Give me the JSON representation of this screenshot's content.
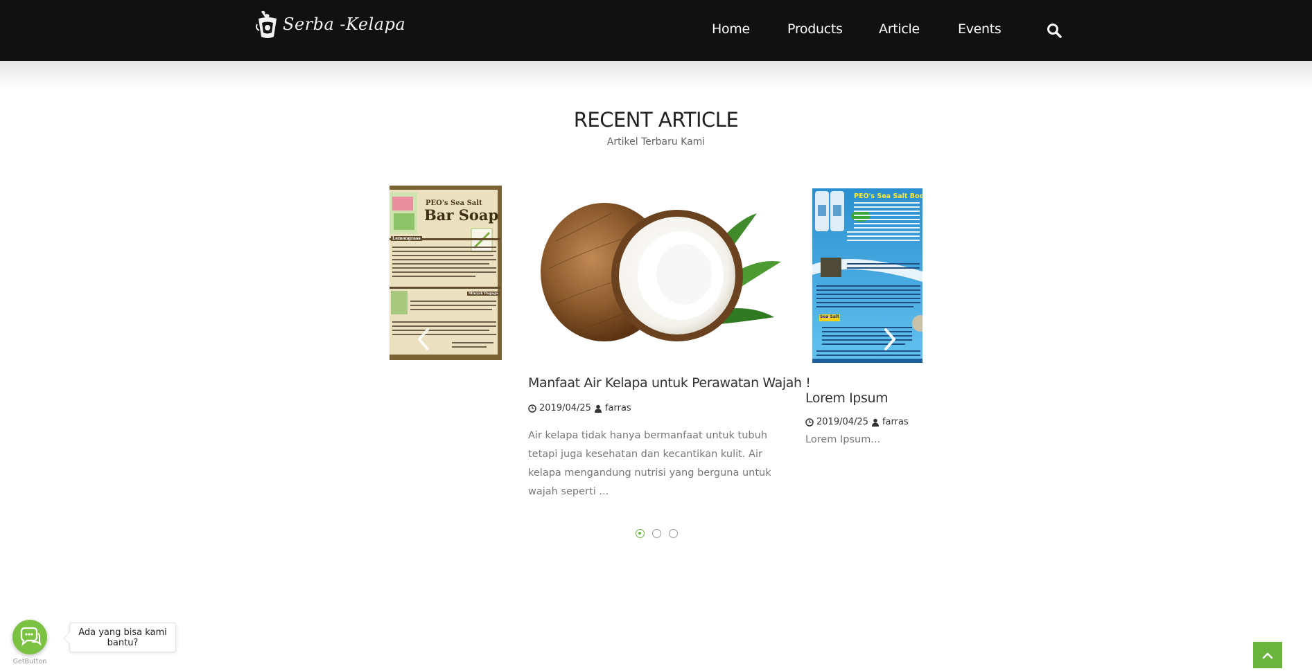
{
  "brand": {
    "name": "Serba -Kelapa"
  },
  "nav": {
    "items": [
      {
        "label": "Home"
      },
      {
        "label": "Products"
      },
      {
        "label": "Article"
      },
      {
        "label": "Events"
      }
    ],
    "search_icon": "search-icon"
  },
  "section": {
    "title": "RECENT ARTICLE",
    "subtitle": "Artikel Terbaru Kami"
  },
  "carousel": {
    "prev_icon": "chevron-left-icon",
    "next_icon": "chevron-right-icon",
    "slides": [
      {
        "image": "bar-soap-flyer",
        "image_text": {
          "brand": "PEO's Sea Salt",
          "product": "Bar Soap",
          "variant": "Lemongrass",
          "variant2": "Minyak Pegaga"
        }
      },
      {
        "image": "coconut-photo",
        "title": "Manfaat Air Kelapa untuk Perawatan Wajah !",
        "date": "2019/04/25",
        "author": "farras",
        "excerpt": "Air kelapa tidak hanya bermanfaat untuk tubuh tetapi juga kesehatan dan kecantikan kulit. Air kelapa mengandung nutrisi yang berguna untuk wajah seperti ..."
      },
      {
        "image": "body-soap-flyer",
        "image_text": {
          "banner": "PEO's Sea Salt Body so",
          "tag": "Sea Salt"
        },
        "title": "Lorem Ipsum",
        "date": "2019/04/25",
        "author": "farras",
        "excerpt": "Lorem Ipsum..."
      }
    ],
    "dots": [
      {
        "active": true
      },
      {
        "active": false
      },
      {
        "active": false
      }
    ]
  },
  "chat": {
    "message": "Ada yang bisa kami bantu?",
    "provider": "GetButton"
  },
  "colors": {
    "navbar": "#111111",
    "accent": "#6ab43e",
    "chat": "#7cc242"
  }
}
